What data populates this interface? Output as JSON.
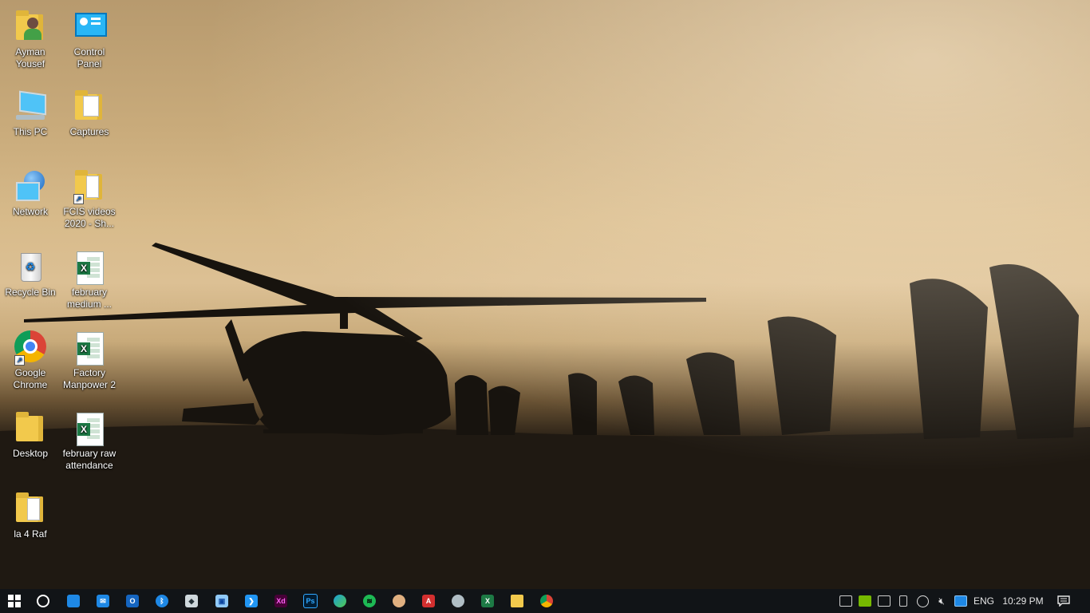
{
  "desktop": {
    "icons": [
      {
        "label_line1": "Ayman",
        "label_line2": "Yousef",
        "icon": "user-folder-icon"
      },
      {
        "label_line1": "Control",
        "label_line2": "Panel",
        "icon": "control-panel-icon"
      },
      {
        "label_line1": "This PC",
        "label_line2": "",
        "icon": "computer-icon"
      },
      {
        "label_line1": "Captures",
        "label_line2": "",
        "icon": "folder-icon"
      },
      {
        "label_line1": "Network",
        "label_line2": "",
        "icon": "network-icon"
      },
      {
        "label_line1": "FCIS videos",
        "label_line2": "2020 - Sh...",
        "icon": "folder-shortcut-icon"
      },
      {
        "label_line1": "Recycle Bin",
        "label_line2": "",
        "icon": "recycle-bin-icon"
      },
      {
        "label_line1": "february",
        "label_line2": "medium ...",
        "icon": "excel-file-icon"
      },
      {
        "label_line1": "Google",
        "label_line2": "Chrome",
        "icon": "chrome-icon"
      },
      {
        "label_line1": "Factory",
        "label_line2": "Manpower 2",
        "icon": "excel-file-icon"
      },
      {
        "label_line1": "Desktop",
        "label_line2": "",
        "icon": "folder-icon"
      },
      {
        "label_line1": "february raw",
        "label_line2": "attendance",
        "icon": "excel-file-icon"
      },
      {
        "label_line1": "la 4 Raf",
        "label_line2": "",
        "icon": "folder-icon"
      }
    ]
  },
  "taskbar": {
    "apps": [
      {
        "name": "start",
        "icon": "windows-logo-icon",
        "color": "#ffffff"
      },
      {
        "name": "cortana",
        "icon": "cortana-circle-icon",
        "color": "#ffffff"
      },
      {
        "name": "store",
        "icon": "store-bag-icon",
        "color": "#1e88e5"
      },
      {
        "name": "mail",
        "icon": "mail-icon",
        "color": "#1e88e5"
      },
      {
        "name": "outlook",
        "icon": "outlook-icon",
        "color": "#1565c0"
      },
      {
        "name": "bluetooth",
        "icon": "bluetooth-icon",
        "color": "#1e88e5"
      },
      {
        "name": "sketch-app",
        "icon": "diamond-app-icon",
        "color": "#cfd8dc"
      },
      {
        "name": "3d-viewer",
        "icon": "cube-icon",
        "color": "#90caf9"
      },
      {
        "name": "vscode",
        "icon": "vscode-icon",
        "color": "#2196f3"
      },
      {
        "name": "adobe-xd",
        "icon": "xd-icon",
        "color": "#470137",
        "text": "Xd"
      },
      {
        "name": "photoshop",
        "icon": "photoshop-icon",
        "color": "#001d34",
        "text": "Ps"
      },
      {
        "name": "edge",
        "icon": "edge-icon",
        "color": "#1ba0d8"
      },
      {
        "name": "spotify",
        "icon": "spotify-icon",
        "color": "#1db954"
      },
      {
        "name": "paint",
        "icon": "paint-palette-icon",
        "color": "#e0b080"
      },
      {
        "name": "acrobat",
        "icon": "acrobat-icon",
        "color": "#d32f2f"
      },
      {
        "name": "disk-tool",
        "icon": "disk-icon",
        "color": "#b0bec5"
      },
      {
        "name": "excel",
        "icon": "excel-icon",
        "color": "#1d7a45",
        "text": "X"
      },
      {
        "name": "file-explorer",
        "icon": "folder-icon",
        "color": "#f2c94c"
      },
      {
        "name": "chrome",
        "icon": "chrome-icon",
        "color": "#e53935"
      }
    ],
    "tray": {
      "language": "ENG",
      "time": "10:29 PM",
      "icons": [
        "usb-icon",
        "nvidia-icon",
        "ime-icon",
        "device-icon",
        "network-globe-icon",
        "volume-muted-icon",
        "app-tray-icon"
      ]
    }
  }
}
